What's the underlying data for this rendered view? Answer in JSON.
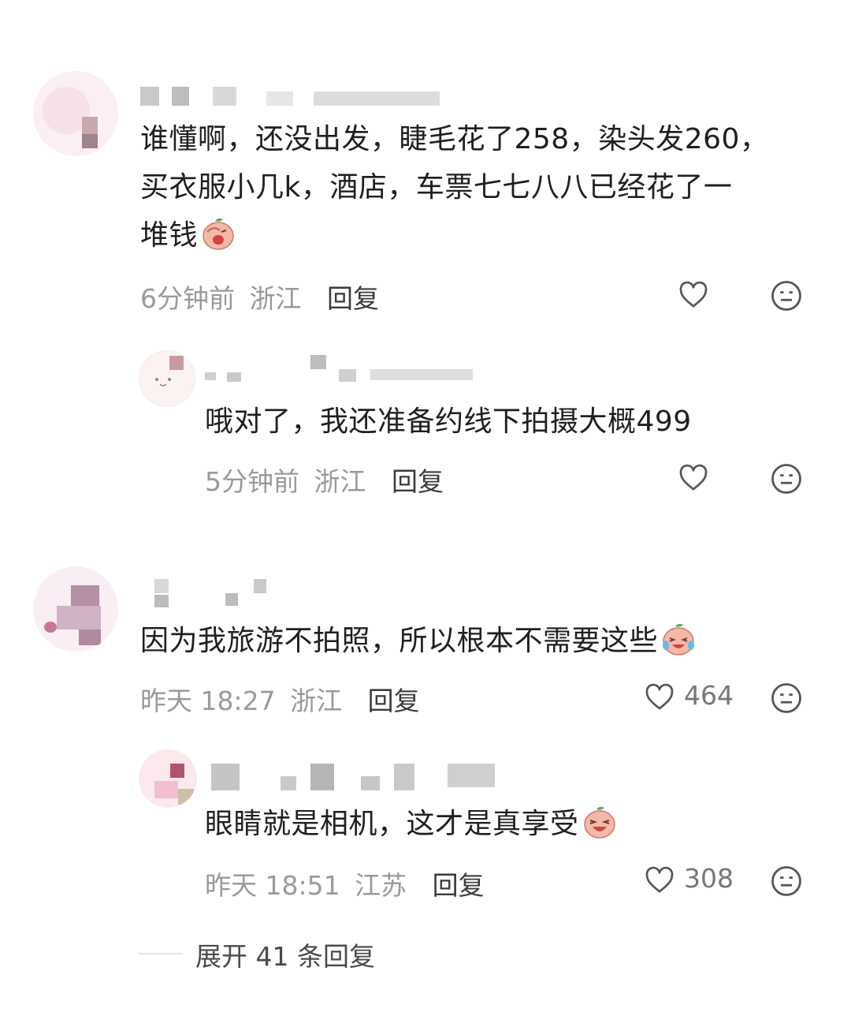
{
  "comments": [
    {
      "text_lines": [
        "谁懂啊，还没出发，睫毛花了258，染头发260，",
        "买衣服小几k，酒店，车票七七八八已经花了一",
        "堆钱"
      ],
      "emoji": "facepalm-peach-emoji",
      "time": "6分钟前",
      "location": "浙江",
      "reply_label": "回复",
      "likes": "",
      "replies": [
        {
          "text": "哦对了，我还准备约线下拍摄大概499",
          "time": "5分钟前",
          "location": "浙江",
          "reply_label": "回复",
          "likes": ""
        }
      ]
    },
    {
      "text": "因为我旅游不拍照，所以根本不需要这些",
      "emoji": "crying-laughing-peach-emoji",
      "time": "昨天 18:27",
      "location": "浙江",
      "reply_label": "回复",
      "likes": "464",
      "replies": [
        {
          "text": "眼睛就是相机，这才是真享受",
          "emoji": "laughing-peach-emoji",
          "time": "昨天 18:51",
          "location": "江苏",
          "reply_label": "回复",
          "likes": "308"
        }
      ]
    }
  ],
  "expand": {
    "label": "展开 41 条回复"
  },
  "icons": {
    "like": "heart-outline-icon",
    "dislike": "meh-face-icon"
  },
  "colors": {
    "text": "#1f1f1f",
    "meta": "#9a9a9a",
    "icon": "#555555"
  }
}
